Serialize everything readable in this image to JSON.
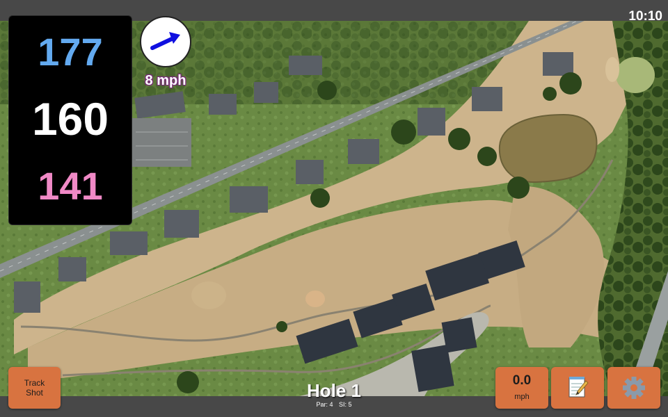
{
  "status_bar": {
    "time": "10:10"
  },
  "distances": {
    "back": "177",
    "middle": "160",
    "front": "141",
    "colors": {
      "back": "#63aaf0",
      "middle": "#ffffff",
      "front": "#f089c6"
    }
  },
  "wind": {
    "speed_label": "8 mph",
    "icon": "wind-direction-arrow-icon"
  },
  "track_shot": {
    "line1": "Track",
    "line2": "Shot"
  },
  "speed": {
    "value": "0.0",
    "unit": "mph"
  },
  "notes": {
    "icon": "notepad-pencil-icon"
  },
  "settings": {
    "icon": "gear-icon"
  },
  "hole": {
    "title": "Hole 1",
    "par": "Par: 4",
    "si": "SI: 5"
  },
  "colors": {
    "button": "#d87340",
    "fairway": "#cdb48c",
    "grass": "#5c7a3a",
    "pond": "#8a7a4a"
  }
}
